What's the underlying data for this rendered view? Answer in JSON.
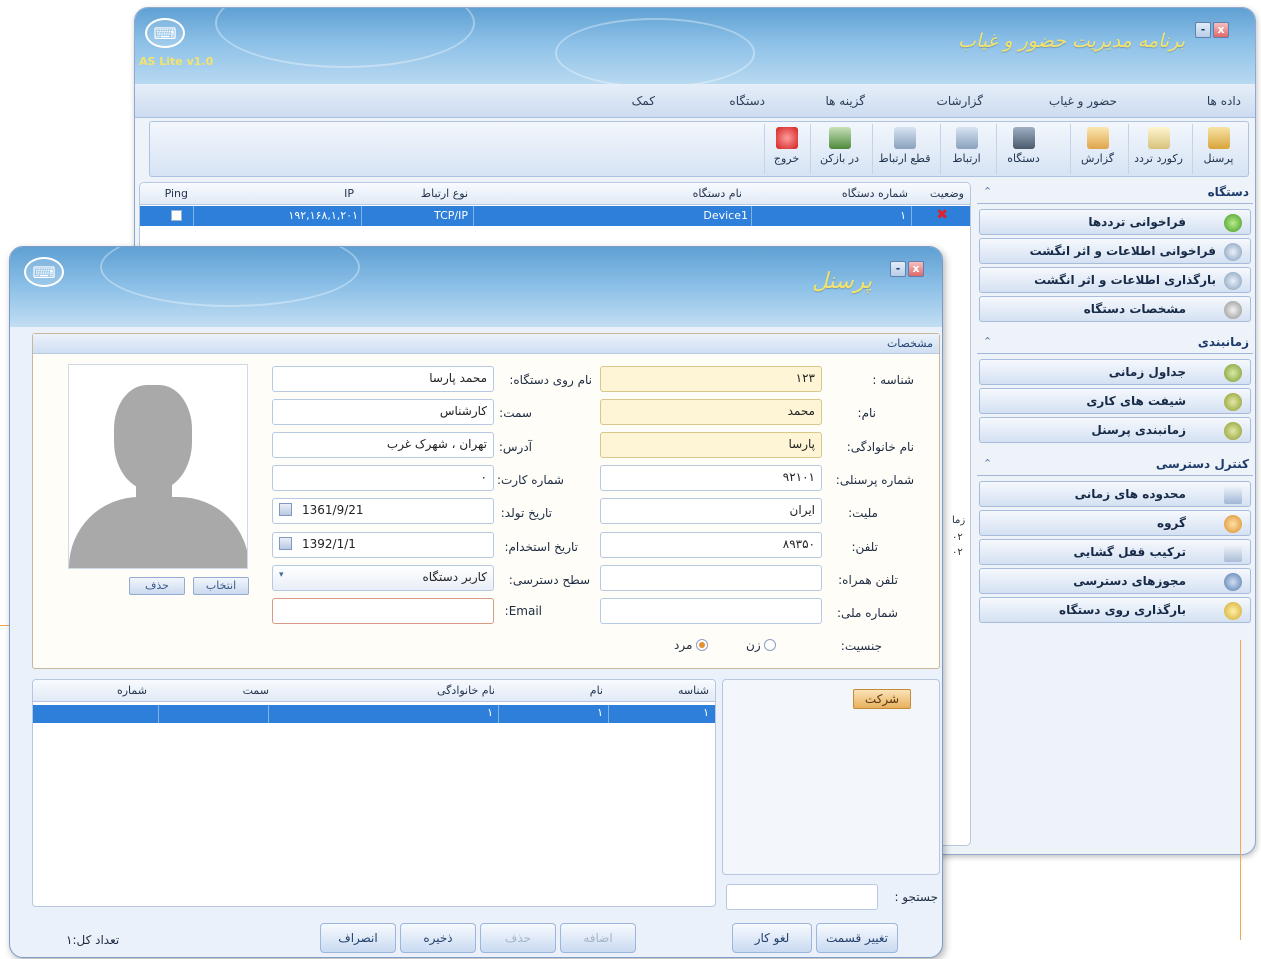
{
  "main_window": {
    "title": "برنامه مدیریت حضور و غیاب",
    "version": "AS Lite v1.0",
    "menu": [
      "داده ها",
      "حضور و غیاب",
      "گزارشات",
      "گزینه ها",
      "دستگاه",
      "کمک"
    ],
    "toolbar": [
      "پرسنل",
      "رکورد تردد",
      "گزارش",
      "دستگاه",
      "ارتباط",
      "قطع ارتباط",
      "در بازکن",
      "خروج"
    ],
    "device_grid": {
      "columns": [
        "وضعیت",
        "شماره دستگاه",
        "نام دستگاه",
        "نوع ارتباط",
        "IP",
        "Ping"
      ],
      "row": {
        "device_number": "۱",
        "device_name": "Device1",
        "connection": "TCP/IP",
        "ip": "۱۹۲,۱۶۸,۱,۲۰۱"
      }
    },
    "side_panel": {
      "device": {
        "title": "دستگاه",
        "items": [
          "فراخوانی ترددها",
          "فراخوانی اطلاعات و اثر انگشت",
          "بارگذاری اطلاعات و اثر انگشت",
          "مشخصات دستگاه"
        ]
      },
      "scheduling": {
        "title": "زمانبندی",
        "items": [
          "جداول زمانی",
          "شیفت های کاری",
          "زمانبندی پرسنل"
        ]
      },
      "access": {
        "title": "کنترل دسترسی",
        "items": [
          "محدوده های زمانی",
          "گروه",
          "ترکیب قفل گشایی",
          "مجوزهای دسترسی",
          "بارگذاری روی دستگاه"
        ]
      }
    },
    "partial_label": "زما",
    "partial_values": [
      "۰۲",
      "۰۲"
    ]
  },
  "person_window": {
    "title": "پرسنل",
    "section_title": "مشخصات",
    "labels": {
      "id": "شناسه :",
      "first_name": "نام:",
      "last_name": "نام خانوادگی:",
      "personnel_no": "شماره پرسنلی:",
      "nationality": "ملیت:",
      "phone": "تلفن:",
      "mobile": "تلفن همراه:",
      "national_id": "شماره ملی:",
      "gender": "جنسیت:",
      "device_name": "نام روی دستگاه:",
      "position": "سمت:",
      "address": "آدرس:",
      "card_no": "شماره کارت:",
      "birth_date": "تاریخ تولد:",
      "hire_date": "تاریخ استخدام:",
      "access_level": "سطح دسترسی:",
      "email": ":Email"
    },
    "values": {
      "id": "۱۲۳",
      "first_name": "محمد",
      "last_name": "پارسا",
      "personnel_no": "۹۲۱۰۱",
      "nationality": "ایران",
      "phone": "۸۹۳۵۰",
      "mobile": "",
      "national_id": "",
      "device_name": "محمد پارسا",
      "position": "کارشناس",
      "address": "تهران ، شهرک غرب",
      "card_no": "۰",
      "birth_date": "1361/9/21",
      "hire_date": "1392/1/1",
      "access_level": "کاربر دستگاه",
      "email": ""
    },
    "gender_options": {
      "female": "زن",
      "male": "مرد",
      "selected": "مرد"
    },
    "photo_buttons": {
      "select": "انتخاب",
      "delete": "حذف"
    },
    "lower_grid": {
      "columns": [
        "شناسه",
        "نام",
        "نام خانوادگی",
        "سمت",
        "شماره"
      ],
      "row": [
        "۱",
        "۱",
        "۱",
        "",
        ""
      ]
    },
    "company_button": "شرکت",
    "search_label": "جستجو :",
    "search_value": "",
    "buttons": {
      "change_section": "تغییر قسمت",
      "cancel_work": "لغو کار",
      "add": "اضافه",
      "delete": "حذف",
      "save": "ذخیره",
      "cancel": "انصراف"
    },
    "total_count": "تعداد کل:۱"
  }
}
